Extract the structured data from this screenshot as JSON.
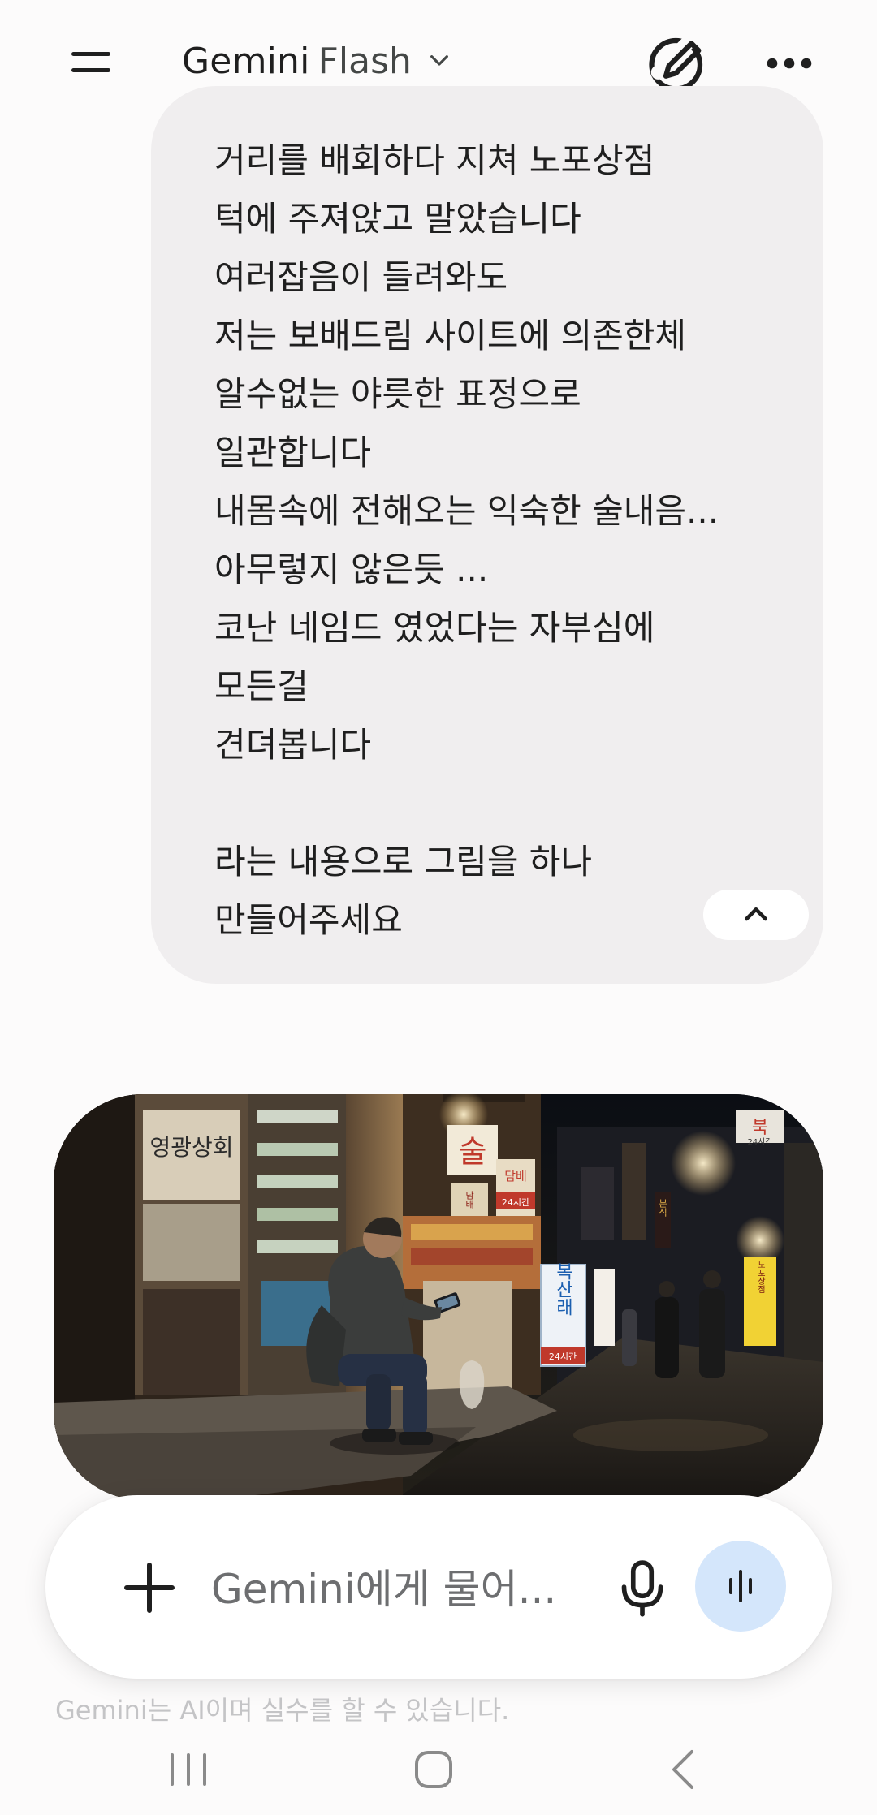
{
  "header": {
    "model_name": "Gemini",
    "model_variant": "Flash",
    "icons": [
      "menu-icon",
      "chevron-down-icon",
      "edit-icon",
      "more-horizontal-icon"
    ]
  },
  "prompt": {
    "lines": [
      "거리를 배회하다 지쳐 노포상점",
      "턱에 주져앉고 말았습니다",
      "여러잡음이 들려와도",
      "저는 보배드림 사이트에 의존한체",
      "알수없는 야릇한 표정으로",
      "일관합니다",
      "내몸속에 전해오는 익숙한 술내음...",
      "아무렇지 않은듯 ...",
      "코난 네임드 였었다는 자부심에",
      "모든걸",
      "견뎌봅니다",
      "",
      "라는 내용으로 그림을 하나",
      "만들어주세요"
    ]
  },
  "image": {
    "signs": {
      "shop_name": "영광상회",
      "alcohol": "술",
      "tobacco": "담배",
      "hours": "24시간",
      "store_vertical": "복산래",
      "store_hours": "24시간",
      "top_right": "북",
      "top_right_hours": "24시간",
      "vertical_left": "담배",
      "shop_right": "분식",
      "yellow_sign": "노포상점"
    }
  },
  "input": {
    "placeholder": "Gemini에게 물어..."
  },
  "disclaimer": "Gemini는 AI이며 실수를 할 수 있습니다.",
  "colors": {
    "background": "#fcfbfb",
    "bubble": "#f0eeef",
    "live_button": "#d4e6fb",
    "text": "#1f1f1f"
  }
}
